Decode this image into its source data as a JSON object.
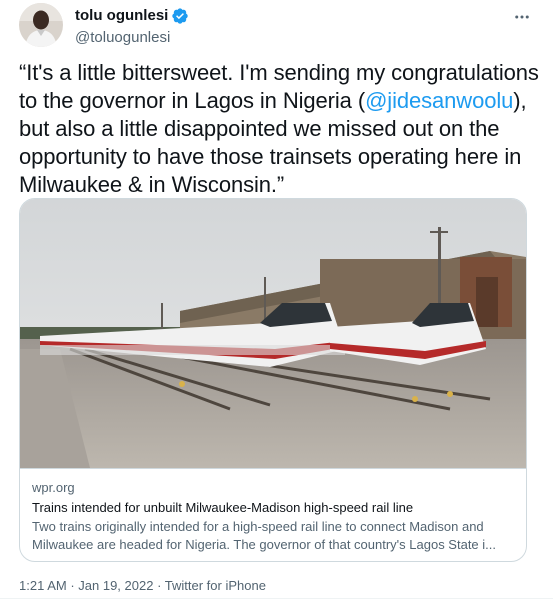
{
  "author": {
    "name": "tolu ogunlesi",
    "handle": "@toluogunlesi",
    "verified": true
  },
  "tweet": {
    "text_before_mention": "“It's a little bittersweet. I'm sending my congratulations to the governor in Lagos in Nigeria (",
    "mention": "@jidesanwoolu",
    "text_after_mention": "), but also a little disappointed we missed out on the opportunity to have those trainsets operating here in Milwaukee & in Wisconsin.”"
  },
  "card": {
    "domain": "wpr.org",
    "title": "Trains intended for unbuilt Milwaukee-Madison high-speed rail line",
    "description": "Two trains originally intended for a high-speed rail line to connect Madison and Milwaukee are headed for Nigeria. The governor of that country's Lagos State i..."
  },
  "meta": {
    "time": "1:21 AM",
    "separator1": " · ",
    "date": "Jan 19, 2022",
    "separator2": " · ",
    "source": "Twitter for iPhone"
  },
  "icons": {
    "verified": "verified-badge-icon",
    "more": "more-options-icon"
  },
  "colors": {
    "link": "#1d9bf0",
    "text": "#0f1419",
    "secondary": "#536471",
    "border": "#cfd9de"
  }
}
